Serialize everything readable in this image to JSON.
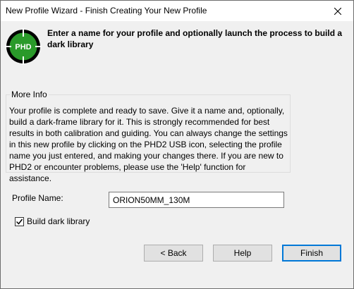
{
  "window": {
    "title": "New Profile Wizard - Finish Creating Your New Profile",
    "close_icon": "close-icon"
  },
  "logo": {
    "icon": "phd2-logo-icon",
    "text": "PHD",
    "colors": {
      "ring": "#000000",
      "fill": "#1e8a1e",
      "crosshair": "#ffffff"
    }
  },
  "header": {
    "text": "Enter a name for your profile and optionally launch the process to build a dark library"
  },
  "more_info": {
    "legend": "More Info",
    "body": "Your profile is complete and ready to save.  Give it a name and, optionally, build a dark-frame library for it.  This is strongly recommended for best results in both calibration and guiding. You can always change the settings in this new profile by clicking on the PHD2 USB icon, selecting the profile name you just entered, and making your changes there. If you are new to PHD2 or encounter problems, please use the 'Help' function for assistance."
  },
  "profile_name": {
    "label": "Profile Name:",
    "value": "ORION50MM_130M"
  },
  "build_dark_library": {
    "label": "Build dark library",
    "checked": true
  },
  "buttons": {
    "back": "< Back",
    "help": "Help",
    "finish": "Finish"
  },
  "colors": {
    "accent": "#0078d7",
    "background": "#f0f0f0"
  }
}
